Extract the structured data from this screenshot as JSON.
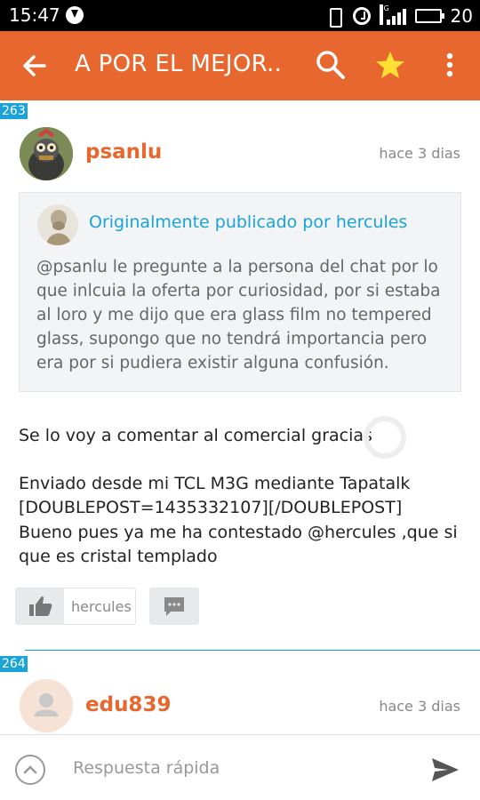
{
  "status_bar": {
    "time": "15:47",
    "network": "4G",
    "battery": "20"
  },
  "app_bar": {
    "title": "A POR EL MEJOR..",
    "accent": "#e8672e"
  },
  "posts": [
    {
      "number": "263",
      "username": "psanlu",
      "date": "hace 3 dias",
      "quote": {
        "header": "Originalmente publicado por hercules",
        "lines": [
          "@psanlu le pregunte a la persona del chat por lo",
          "que inlcuia la oferta por curiosidad, por si estaba",
          "al loro y me dijo que era glass film no tempered",
          "glass, supongo que no tendrá importancia pero",
          "era por si pudiera existir alguna confusión."
        ]
      },
      "body_lines": [
        "Se lo voy a comentar al comercial gracias",
        "",
        "Enviado desde mi TCL M3G mediante Tapatalk",
        "[DOUBLEPOST=1435332107][/DOUBLEPOST]",
        "Bueno pues ya me ha contestado @hercules ,que si",
        "que es cristal templado"
      ],
      "liked_by": "hercules"
    },
    {
      "number": "264",
      "username": "edu839",
      "date": "hace 3 dias"
    }
  ],
  "quick_reply": {
    "placeholder": "Respuesta rápida"
  },
  "colors": {
    "accent": "#e8672e",
    "link": "#1aa3d8"
  }
}
